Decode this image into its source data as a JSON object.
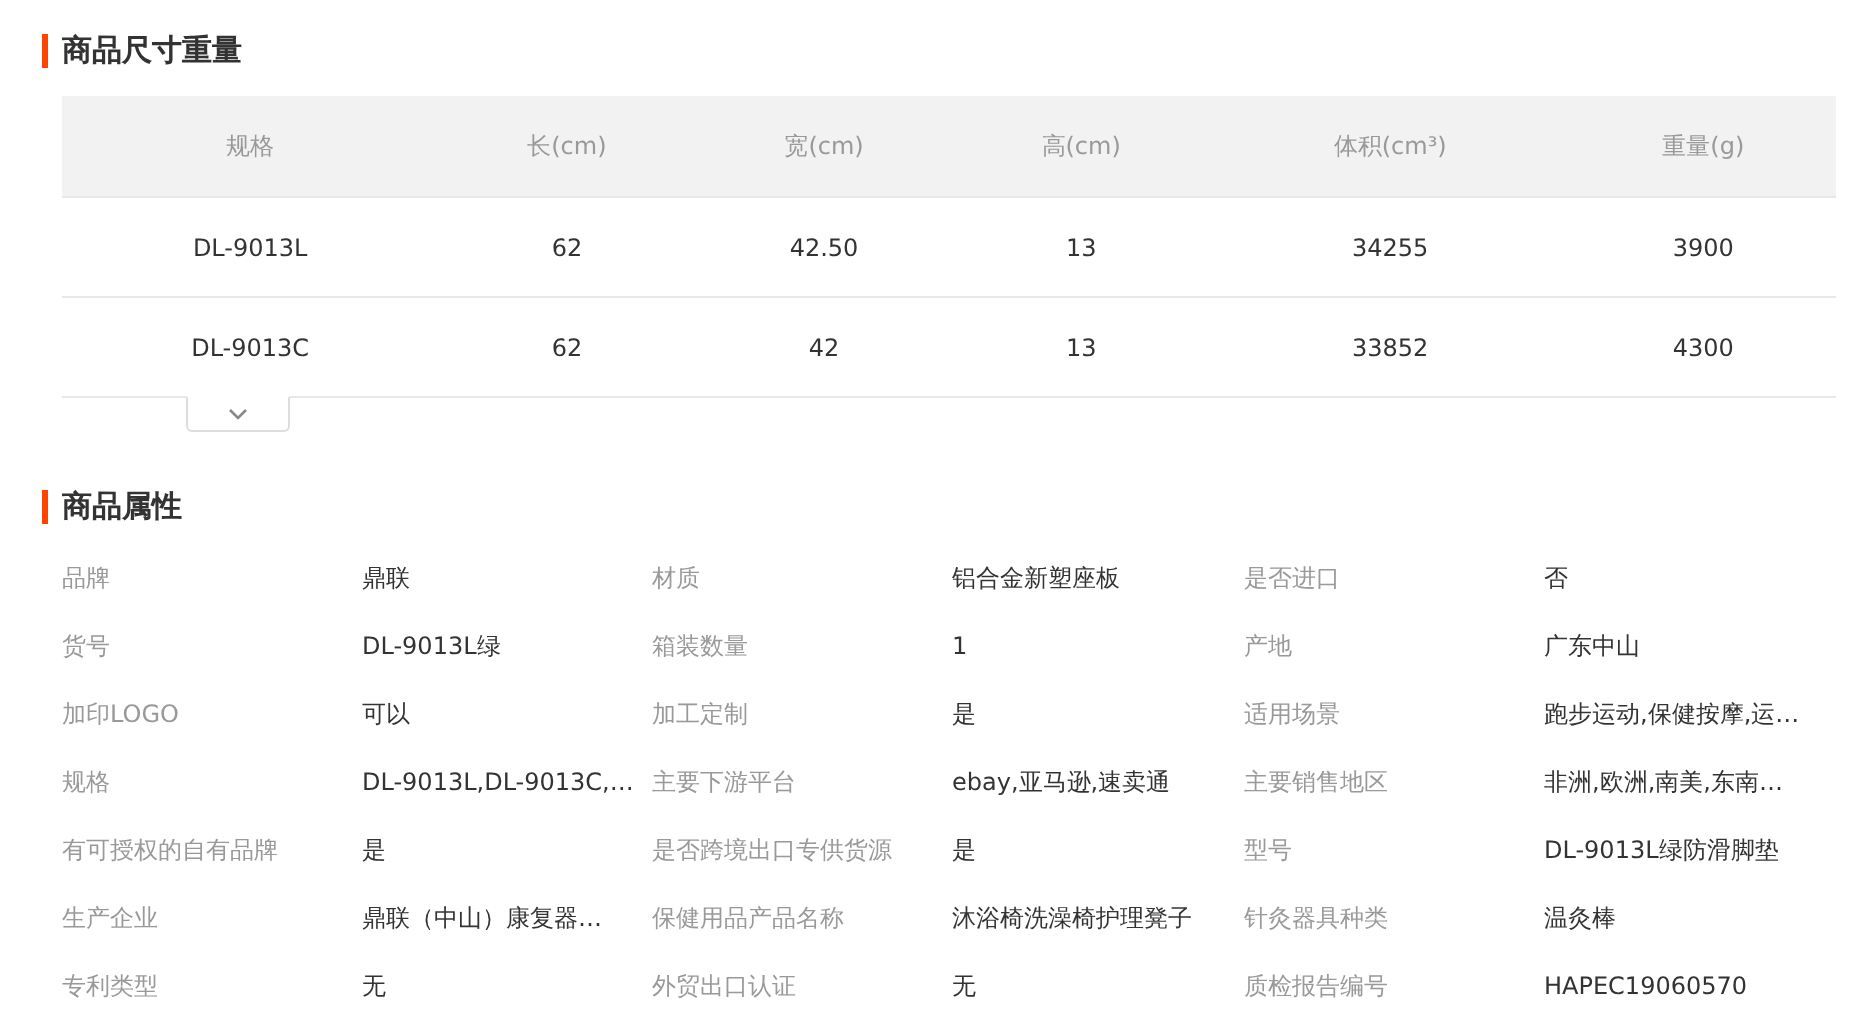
{
  "size_section": {
    "title": "商品尺寸重量",
    "columns": [
      "规格",
      "长(cm)",
      "宽(cm)",
      "高(cm)",
      "体积(cm³)",
      "重量(g)"
    ],
    "rows": [
      [
        "DL-9013L",
        "62",
        "42.50",
        "13",
        "34255",
        "3900"
      ],
      [
        "DL-9013C",
        "62",
        "42",
        "13",
        "33852",
        "4300"
      ]
    ]
  },
  "attributes_section": {
    "title": "商品属性",
    "items": [
      {
        "label": "品牌",
        "value": "鼎联"
      },
      {
        "label": "材质",
        "value": "铝合金新塑座板"
      },
      {
        "label": "是否进口",
        "value": "否"
      },
      {
        "label": "货号",
        "value": "DL-9013L绿"
      },
      {
        "label": "箱装数量",
        "value": "1"
      },
      {
        "label": "产地",
        "value": "广东中山"
      },
      {
        "label": "加印LOGO",
        "value": "可以"
      },
      {
        "label": "加工定制",
        "value": "是"
      },
      {
        "label": "适用场景",
        "value": "跑步运动,保健按摩,运…"
      },
      {
        "label": "规格",
        "value": "DL-9013L,DL-9013C,…"
      },
      {
        "label": "主要下游平台",
        "value": "ebay,亚马逊,速卖通"
      },
      {
        "label": "主要销售地区",
        "value": "非洲,欧洲,南美,东南…"
      },
      {
        "label": "有可授权的自有品牌",
        "value": "是"
      },
      {
        "label": "是否跨境出口专供货源",
        "value": "是"
      },
      {
        "label": "型号",
        "value": "DL-9013L绿防滑脚垫"
      },
      {
        "label": "生产企业",
        "value": "鼎联（中山）康复器…"
      },
      {
        "label": "保健用品产品名称",
        "value": "沐浴椅洗澡椅护理凳子"
      },
      {
        "label": "针灸器具种类",
        "value": "温灸棒"
      },
      {
        "label": "专利类型",
        "value": "无"
      },
      {
        "label": "外贸出口认证",
        "value": "无"
      },
      {
        "label": "质检报告编号",
        "value": "HAPEC19060570"
      }
    ]
  }
}
